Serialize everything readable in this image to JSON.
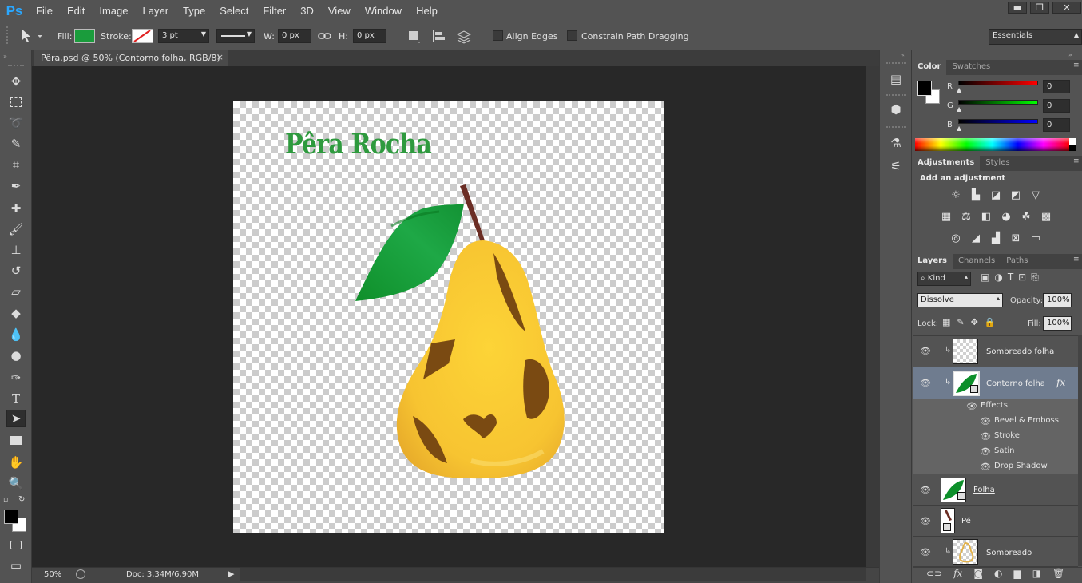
{
  "app": {
    "logo": "Ps"
  },
  "menu": [
    "File",
    "Edit",
    "Image",
    "Layer",
    "Type",
    "Select",
    "Filter",
    "3D",
    "View",
    "Window",
    "Help"
  ],
  "window_controls": {
    "minimize": "▬",
    "restore": "❐",
    "close": "✕"
  },
  "options": {
    "fill_label": "Fill:",
    "fill_color": "#1a9c3c",
    "stroke_label": "Stroke:",
    "stroke_width": "3 pt",
    "w_label": "W:",
    "w_value": "0 px",
    "h_label": "H:",
    "h_value": "0 px",
    "align_edges": "Align Edges",
    "constrain": "Constrain Path Dragging",
    "workspace": "Essentials"
  },
  "document": {
    "tab_title": "Pêra.psd @ 50% (Contorno folha, RGB/8)",
    "close_glyph": "×",
    "canvas_title": "Pêra Rocha"
  },
  "status": {
    "zoom": "50%",
    "doc": "Doc: 3,34M/6,90M"
  },
  "color_panel": {
    "tabs": [
      "Color",
      "Swatches"
    ],
    "r_label": "R",
    "g_label": "G",
    "b_label": "B",
    "r": "0",
    "g": "0",
    "b": "0"
  },
  "adjustments_panel": {
    "tabs": [
      "Adjustments",
      "Styles"
    ],
    "heading": "Add an adjustment"
  },
  "layers_panel": {
    "tabs": [
      "Layers",
      "Channels",
      "Paths"
    ],
    "filter": "Kind",
    "blend_mode": "Dissolve",
    "opacity_label": "Opacity:",
    "opacity": "100%",
    "lock_label": "Lock:",
    "fill_label": "Fill:",
    "fill": "100%",
    "effects_label": "Effects",
    "fx": "fx",
    "layers": [
      {
        "name": "Sombreado folha"
      },
      {
        "name": "Contorno folha"
      },
      {
        "name": "Folha"
      },
      {
        "name": "Pé"
      },
      {
        "name": "Sombreado"
      }
    ],
    "effects": [
      "Bevel & Emboss",
      "Stroke",
      "Satin",
      "Drop Shadow"
    ]
  }
}
